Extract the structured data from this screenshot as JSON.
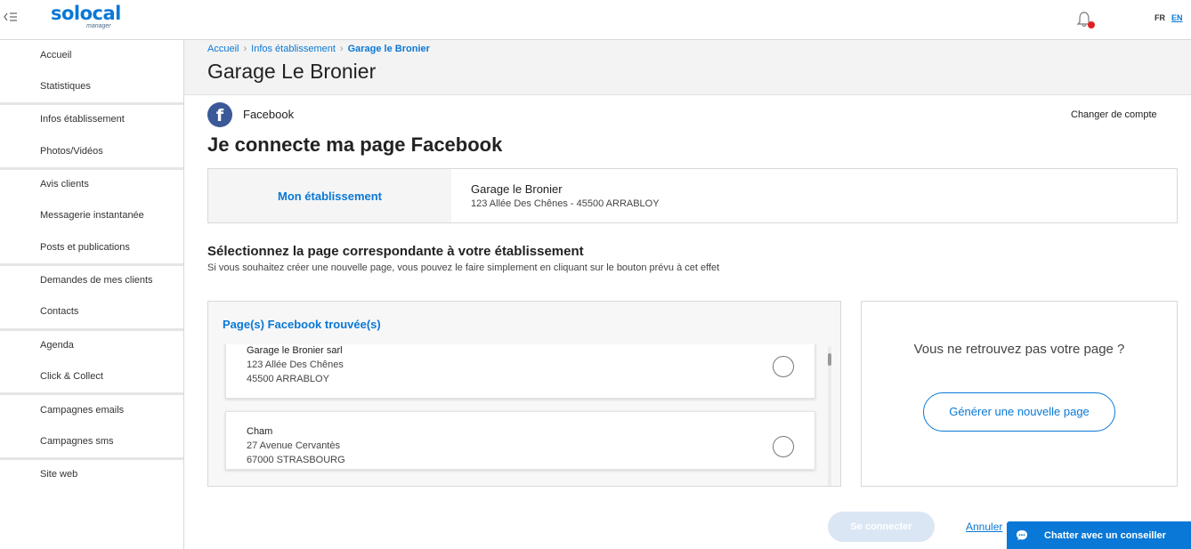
{
  "brand": {
    "name": "solocal",
    "sub": "manager"
  },
  "languages": {
    "fr": "FR",
    "en": "EN"
  },
  "sidebar": {
    "items": [
      {
        "label": "Accueil"
      },
      {
        "label": "Statistiques"
      },
      {
        "label": "Infos établissement"
      },
      {
        "label": "Photos/Vidéos"
      },
      {
        "label": "Avis clients"
      },
      {
        "label": "Messagerie instantanée"
      },
      {
        "label": "Posts et publications"
      },
      {
        "label": "Demandes de mes clients"
      },
      {
        "label": "Contacts"
      },
      {
        "label": "Agenda"
      },
      {
        "label": "Click & Collect"
      },
      {
        "label": "Campagnes emails"
      },
      {
        "label": "Campagnes sms"
      },
      {
        "label": "Site web"
      }
    ]
  },
  "breadcrumb": {
    "items": [
      "Accueil",
      "Infos établissement",
      "Garage le Bronier"
    ]
  },
  "page_title": "Garage Le Bronier",
  "provider": {
    "icon": "facebook-icon",
    "label": "Facebook",
    "color": "#3b5998"
  },
  "change_account": "Changer de compte",
  "section_title": "Je connecte ma page Facebook",
  "establishment": {
    "label": "Mon établissement",
    "name": "Garage le Bronier",
    "address": "123 Allée Des Chênes - 45500 ARRABLOY"
  },
  "select": {
    "title": "Sélectionnez la page correspondante à votre établissement",
    "subtitle": "Si vous souhaitez créer une nouvelle page, vous pouvez le faire simplement en cliquant sur le bouton prévu à cet effet"
  },
  "found": {
    "title": "Page(s) Facebook trouvée(s)",
    "pages": [
      {
        "name": "Garage le Bronier sarl",
        "street": "123 Allée Des Chênes",
        "city": "45500 ARRABLOY"
      },
      {
        "name": "Cham",
        "street": "27 Avenue Cervantès",
        "city": "67000 STRASBOURG"
      }
    ]
  },
  "not_found": {
    "text": "Vous ne retrouvez pas votre page ?",
    "button": "Générer une nouvelle page"
  },
  "actions": {
    "connect": "Se connecter",
    "cancel": "Annuler"
  },
  "chat": {
    "label": "Chatter avec un conseiller"
  },
  "colors": {
    "accent": "#0a78d6",
    "notification": "#e02020"
  }
}
